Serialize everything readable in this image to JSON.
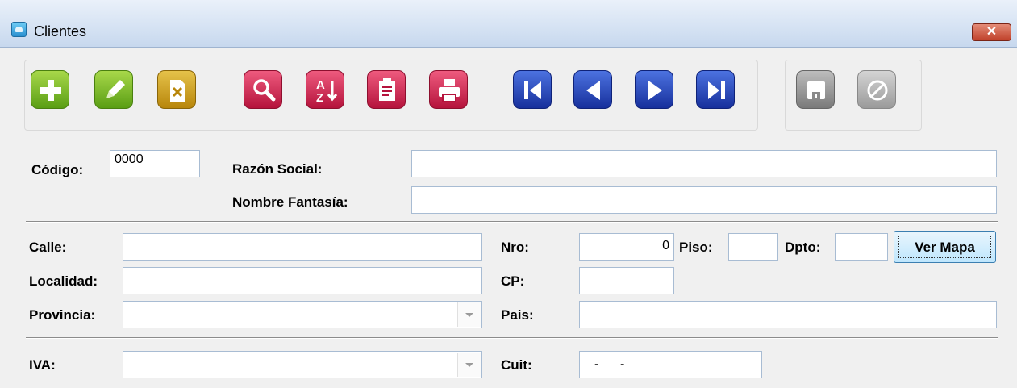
{
  "window": {
    "title": "Clientes",
    "close_label": "✕"
  },
  "toolbar": {
    "buttons": [
      {
        "name": "add-button",
        "icon": "plus-icon"
      },
      {
        "name": "edit-button",
        "icon": "pencil-icon"
      },
      {
        "name": "delete-button",
        "icon": "delete-document-icon"
      },
      {
        "name": "search-button",
        "icon": "magnifier-icon"
      },
      {
        "name": "sort-button",
        "icon": "sort-az-icon"
      },
      {
        "name": "report-button",
        "icon": "clipboard-icon"
      },
      {
        "name": "print-button",
        "icon": "printer-icon"
      },
      {
        "name": "first-record-button",
        "icon": "first-icon"
      },
      {
        "name": "previous-record-button",
        "icon": "previous-icon"
      },
      {
        "name": "next-record-button",
        "icon": "next-icon"
      },
      {
        "name": "last-record-button",
        "icon": "last-icon"
      },
      {
        "name": "save-button",
        "icon": "floppy-disk-icon"
      },
      {
        "name": "cancel-button",
        "icon": "cancel-icon"
      }
    ]
  },
  "form": {
    "codigo": {
      "label": "Código:",
      "value": "0000"
    },
    "razon_social": {
      "label": "Razón Social:",
      "value": ""
    },
    "nombre_fantasia": {
      "label": "Nombre Fantasía:",
      "value": ""
    },
    "calle": {
      "label": "Calle:",
      "value": ""
    },
    "nro": {
      "label": "Nro:",
      "value": "0"
    },
    "piso": {
      "label": "Piso:",
      "value": ""
    },
    "dpto": {
      "label": "Dpto:",
      "value": ""
    },
    "ver_mapa": {
      "label": "Ver Mapa"
    },
    "localidad": {
      "label": "Localidad:",
      "value": ""
    },
    "cp": {
      "label": "CP:",
      "value": ""
    },
    "provincia": {
      "label": "Provincia:",
      "value": ""
    },
    "pais": {
      "label": "Pais:",
      "value": ""
    },
    "iva": {
      "label": "IVA:",
      "value": ""
    },
    "cuit": {
      "label": "Cuit:",
      "value": "-      -"
    }
  }
}
